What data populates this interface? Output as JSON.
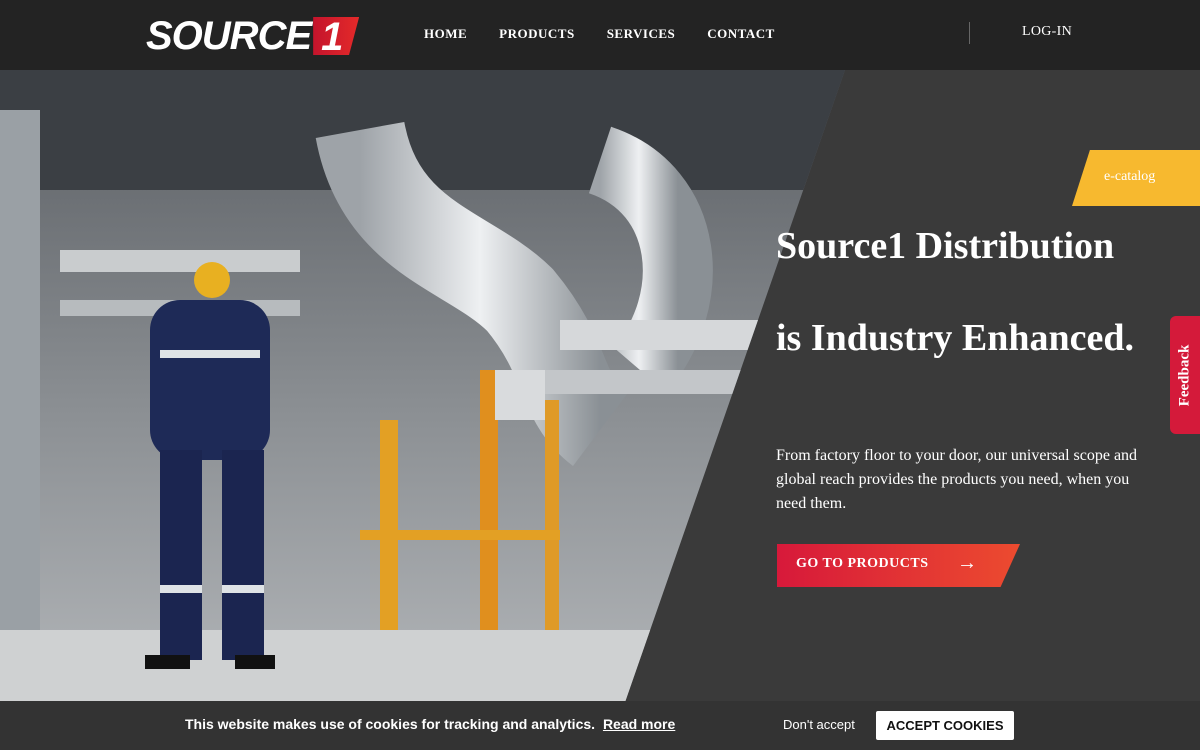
{
  "header": {
    "logo_text": "SOURCE",
    "logo_digit": "1",
    "nav": [
      "HOME",
      "PRODUCTS",
      "SERVICES",
      "CONTACT"
    ],
    "login": "LOG-IN"
  },
  "hero": {
    "ecatalog": "e-catalog",
    "title_line1": "Source1 Distribution",
    "title_line2": "is Industry Enhanced.",
    "description": "From factory floor to your door, our universal scope and global reach provides the products you need, when you need them.",
    "cta_label": "GO TO PRODUCTS",
    "cta_arrow": "→"
  },
  "feedback_label": "Feedback",
  "cookie": {
    "message": "This website makes use of cookies for tracking and analytics.",
    "read_more": "Read more",
    "dont_accept": "Don't accept",
    "accept": "ACCEPT COOKIES"
  },
  "colors": {
    "accent_red": "#d41a3a",
    "accent_yellow": "#f7b92f",
    "header_bg": "#232323",
    "hero_bg": "#3a3a3a"
  },
  "icons": {
    "cta_arrow": "arrow-right-icon"
  }
}
